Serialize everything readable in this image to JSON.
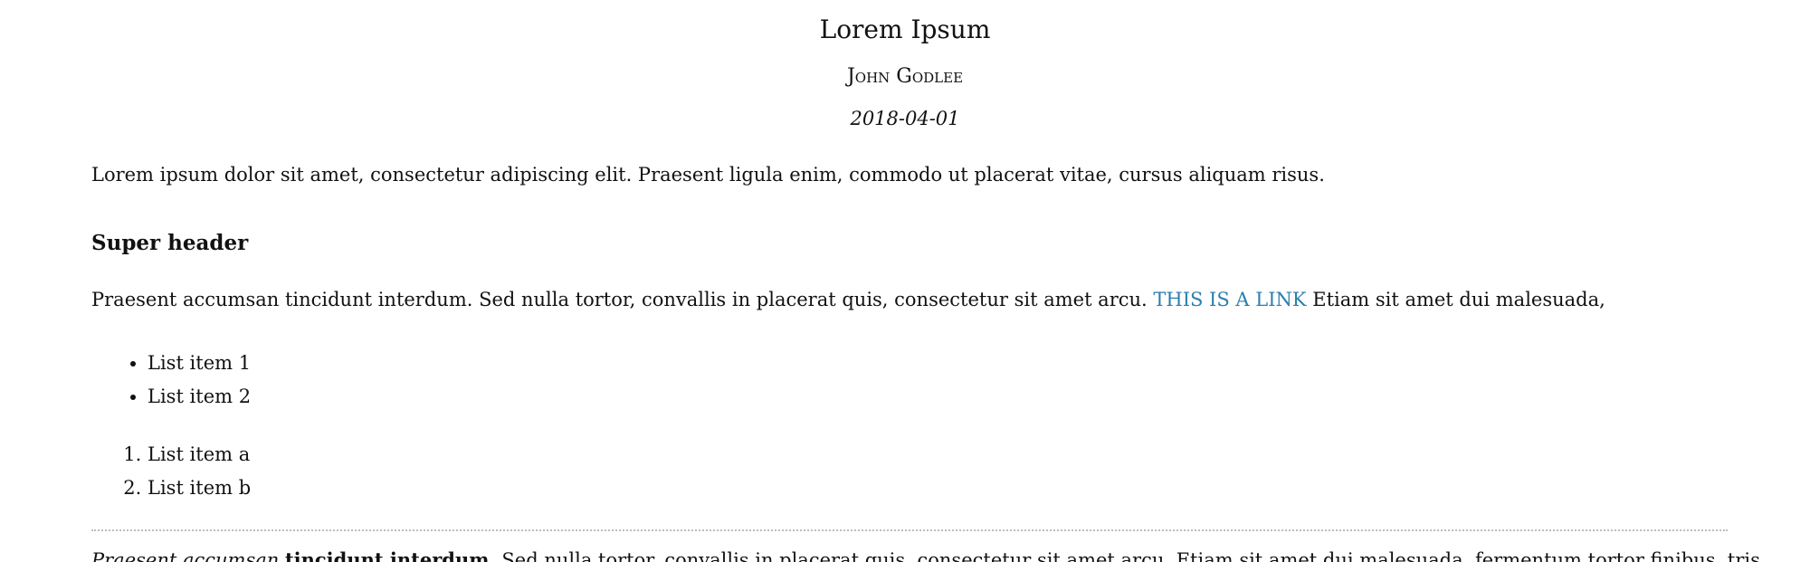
{
  "doc": {
    "title": "Lorem Ipsum",
    "author": "John Godlee",
    "date": "2018-04-01",
    "intro": "Lorem ipsum dolor sit amet, consectetur adipiscing elit. Praesent ligula enim, commodo ut placerat vitae, cursus aliquam risus.",
    "section_header": "Super header",
    "para_before_link": "Praesent accumsan tincidunt interdum. Sed nulla tortor, convallis in placerat quis, consectetur sit amet arcu. ",
    "link_text": "THIS IS A LINK",
    "para_after_link": " Etiam sit amet dui malesuada,",
    "bullets": [
      "List item 1",
      "List item 2"
    ],
    "numbered": [
      "List item a",
      "List item b"
    ],
    "last_italic": "Praesent accumsan",
    "last_bold": "tincidunt interdum.",
    "last_rest": " Sed nulla tortor, convallis in placerat quis, consectetur sit amet arcu. Etiam sit amet dui malesuada, fermentum tortor finibus, tris"
  }
}
